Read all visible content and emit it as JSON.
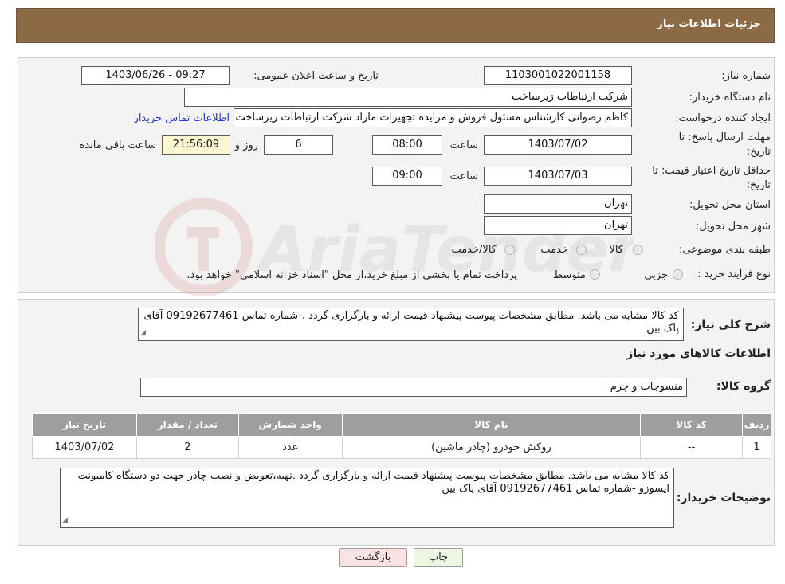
{
  "header": {
    "title": "جزئیات اطلاعات نیاز"
  },
  "form": {
    "need_number_label": "شماره نیاز:",
    "need_number": "1103001022001158",
    "announce_label": "تاریخ و ساعت اعلان عمومی:",
    "announce_value": "1403/06/26 - 09:27",
    "buyer_org_label": "نام دستگاه خریدار:",
    "buyer_org": "شرکت ارتباطات زیرساخت",
    "creator_label": "ایجاد کننده درخواست:",
    "creator": "کاظم رضوانی کارشناس مسئول فروش و مزایده تجهیزات مازاد شرکت ارتباطات زیرساخت",
    "contact_link": "اطلاعات تماس خریدار",
    "deadline_label_1": "مهلت ارسال پاسخ: تا",
    "deadline_label_2": "تاریخ:",
    "deadline_date": "1403/07/02",
    "time_label": "ساعت",
    "deadline_time": "08:00",
    "days_value": "6",
    "days_label": "روز و",
    "remaining_time": "21:56:09",
    "remaining_label": "ساعت باقی مانده",
    "validity_label_1": "حداقل تاریخ اعتبار قیمت: تا",
    "validity_label_2": "تاریخ:",
    "validity_date": "1403/07/03",
    "validity_time": "09:00",
    "province_label": "استان محل تحویل:",
    "province": "تهران",
    "city_label": "شهر محل تحویل:",
    "city": "تهران",
    "category_label": "طبقه بندی موضوعی:",
    "category_options": [
      "کالا",
      "خدمت",
      "کالا/خدمت"
    ],
    "process_label": "نوع فرآیند خرید :",
    "process_options": [
      "جزیی",
      "متوسط"
    ],
    "process_note": "پرداخت تمام یا بخشی از مبلغ خرید،از محل \"اسناد خزانه اسلامی\" خواهد بود."
  },
  "details": {
    "summary_label": "شرح کلی نیاز:",
    "summary_text": "کد کالا مشابه می باشد. مطابق مشخصات پیوست پیشنهاد قیمت ارائه و بارگزاری گردد .-شماره تماس 09192677461 آقای پاک بین",
    "goods_info_title": "اطلاعات کالاهای مورد نیاز",
    "group_label": "گروه کالا:",
    "group_value": "منسوجات و چرم",
    "table": {
      "headers": [
        "ردیف",
        "کد کالا",
        "نام کالا",
        "واحد شمارش",
        "تعداد / مقدار",
        "تاریخ نیاز"
      ],
      "rows": [
        [
          "1",
          "--",
          "روکش خودرو (چادر ماشین)",
          "عدد",
          "2",
          "1403/07/02"
        ]
      ]
    },
    "buyer_notes_label": "توضیحات خریدار:",
    "buyer_notes": "کد کالا مشابه می باشد. مطابق مشخصات پیوست پیشنهاد قیمت ارائه و بارگزاری گردد .تهیه،تعویض و نصب چادر جهت دو دستگاه کامیونت ایسوزو -شماره تماس 09192677461 آقای پاک بین"
  },
  "buttons": {
    "print": "چاپ",
    "back": "بازگشت"
  },
  "watermark": {
    "text": "AriaTender.neT"
  },
  "colors": {
    "header_bg": "#8b6a45",
    "panel_bg": "#f3f3f3",
    "table_header": "#9e9e9e",
    "link": "#2230d8"
  }
}
